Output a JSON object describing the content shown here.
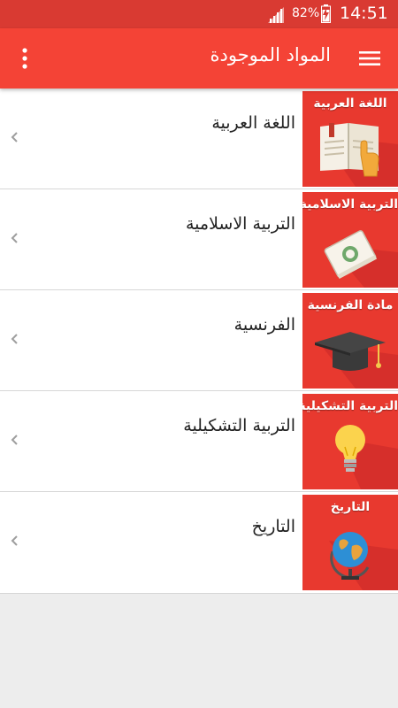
{
  "status_bar": {
    "battery_percent": "82%",
    "time": "14:51"
  },
  "app_bar": {
    "title": "المواد الموجودة",
    "overflow_icon": "more-vert-icon",
    "menu_icon": "hamburger-icon"
  },
  "subjects": [
    {
      "label": "اللغة العربية",
      "thumb_title": "اللغة العربية",
      "icon": "book-icon"
    },
    {
      "label": "التربية الاسلامية",
      "thumb_title": "التربية الاسلامية",
      "icon": "quran-icon"
    },
    {
      "label": "الفرنسية",
      "thumb_title": "مادة الفرنسية",
      "icon": "graduation-cap-icon"
    },
    {
      "label": "التربية التشكيلية",
      "thumb_title": "التربية التشكيلية",
      "icon": "lightbulb-icon"
    },
    {
      "label": "التاريخ",
      "thumb_title": "التاريخ",
      "icon": "globe-icon"
    }
  ],
  "colors": {
    "status_bar": "#d93a32",
    "app_bar": "#f44336",
    "thumb_bg": "#e8392f",
    "background": "#ededed"
  }
}
